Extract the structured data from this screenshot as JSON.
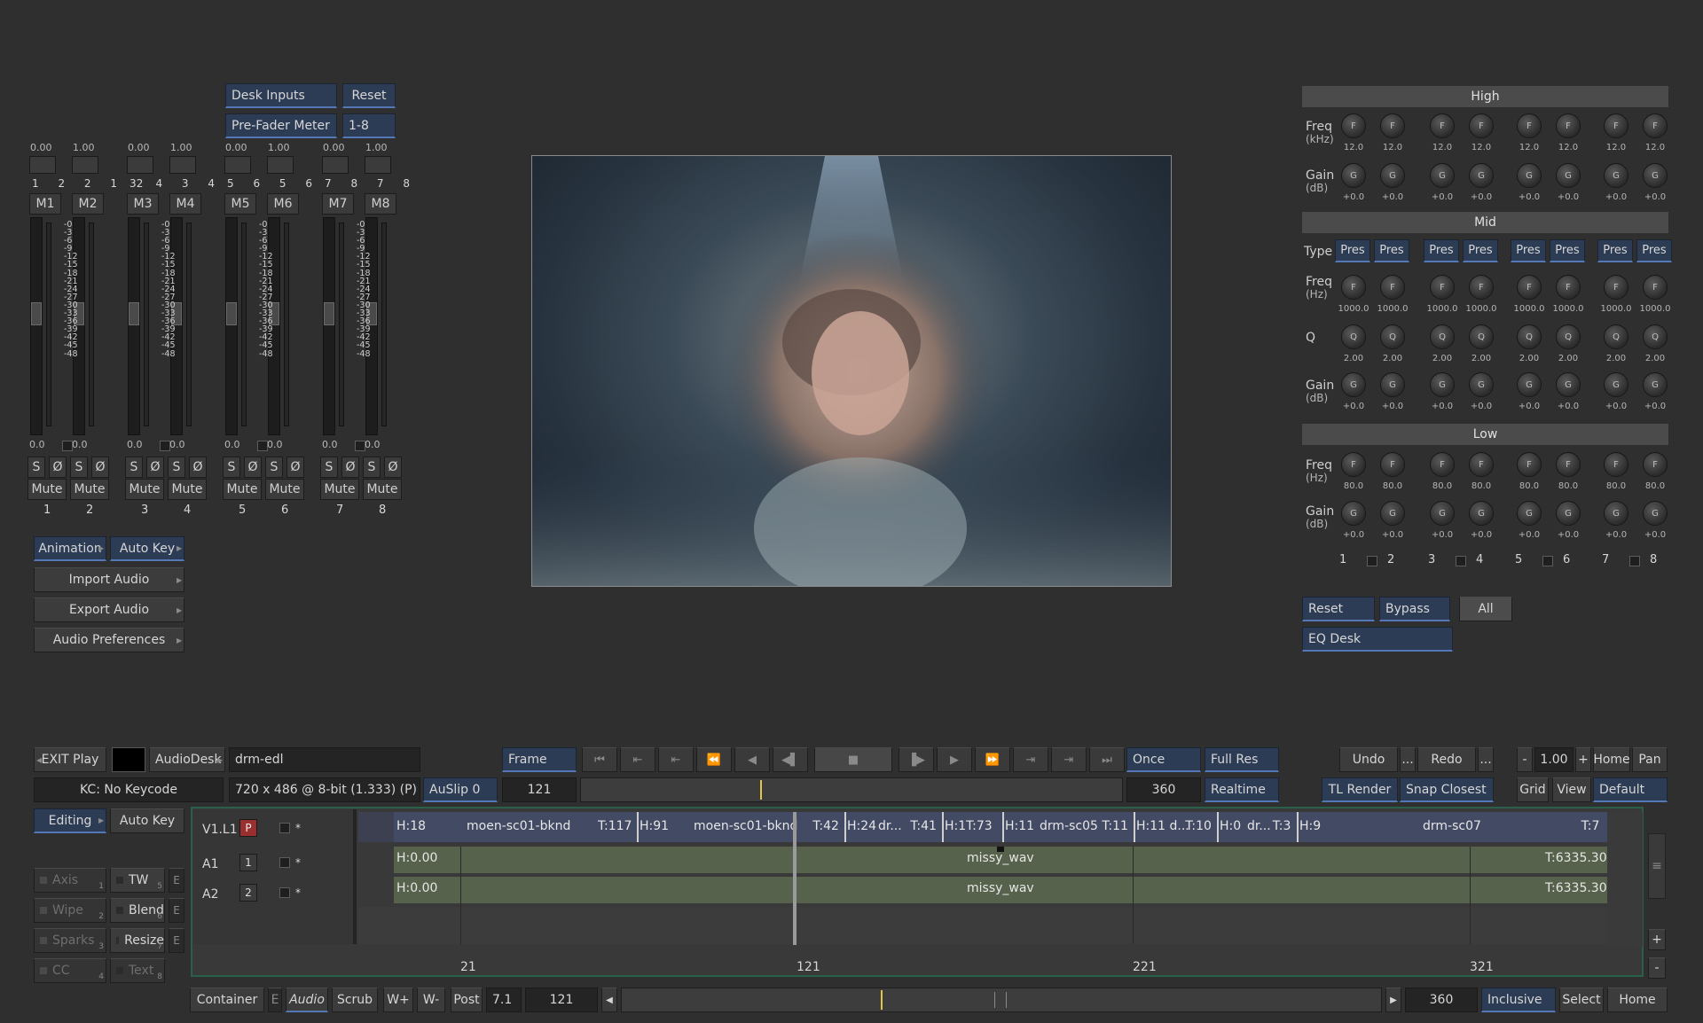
{
  "mixer": {
    "desk_inputs": "Desk Inputs",
    "reset": "Reset",
    "pre_fader_meter": "Pre-Fader Meter",
    "range": "1-8",
    "channel_labels": [
      "M1",
      "M2",
      "M3",
      "M4",
      "M5",
      "M6",
      "M7",
      "M8"
    ],
    "pan_values": [
      "0.00",
      "1.00"
    ],
    "input_numbers": [
      [
        "1",
        "2",
        "2",
        "1",
        "2"
      ],
      [
        "3",
        "4",
        "3",
        "4"
      ],
      [
        "5",
        "6",
        "5",
        "6"
      ],
      [
        "7",
        "8",
        "7",
        "8"
      ]
    ],
    "scale": "-0\n-3\n-6\n-9\n-12\n-15\n-18\n-21\n-24\n-27\n-30\n-33\n-36\n-39\n-42\n-45\n-48",
    "fader_value": "0.0",
    "solo": "S",
    "phase": "Ø",
    "mute": "Mute",
    "track_numbers": [
      "1",
      "2",
      "3",
      "4",
      "5",
      "6",
      "7",
      "8"
    ]
  },
  "side_menu": {
    "animation": "Animation",
    "auto_key": "Auto Key",
    "import_audio": "Import Audio",
    "export_audio": "Export Audio",
    "audio_preferences": "Audio Preferences"
  },
  "eq": {
    "high": "High",
    "mid": "Mid",
    "low": "Low",
    "freq": "Freq",
    "khz": "(kHz)",
    "hz": "(Hz)",
    "gain": "Gain",
    "db": "(dB)",
    "type": "Type",
    "q": "Q",
    "pres": "Pres",
    "f": "F",
    "g": "G",
    "qk": "Q",
    "high_freq": "12.0",
    "gain_val": "+0.0",
    "mid_freq": "1000.0",
    "q_val": "2.00",
    "low_freq": "80.0",
    "band_nums": [
      "1",
      "2",
      "3",
      "4",
      "5",
      "6",
      "7",
      "8"
    ],
    "reset": "Reset",
    "bypass": "Bypass",
    "all": "All",
    "eq_desk": "EQ Desk"
  },
  "transport": {
    "exit_play": "EXIT Play",
    "audiodesk": "AudioDesk",
    "edl_name": "drm-edl",
    "keycode": "KC: No Keycode",
    "format": "720 x 486 @ 8-bit (1.333) (P)",
    "frame": "Frame",
    "auslip": "AuSlip 0",
    "current_frame": "121",
    "end_frame": "360",
    "once": "Once",
    "realtime": "Realtime",
    "full_res": "Full Res",
    "undo": "Undo",
    "redo": "Redo",
    "ellipsis": "...",
    "minus": "-",
    "plus": "+",
    "zoom": "1.00",
    "home": "Home",
    "pan": "Pan",
    "tl_render": "TL Render",
    "snap": "Snap Closest",
    "grid": "Grid",
    "view": "View",
    "default": "Default",
    "editing": "Editing",
    "auto_key": "Auto Key"
  },
  "tools": {
    "axis": "Axis",
    "wipe": "Wipe",
    "sparks": "Sparks",
    "cc": "CC",
    "tw": "TW",
    "blend": "Blend",
    "resize": "Resize",
    "text": "Text",
    "e": "E",
    "n1": "1",
    "n2": "2",
    "n3": "3",
    "n4": "4",
    "n5": "5",
    "n6": "6",
    "n7": "7",
    "n8": "8"
  },
  "timeline": {
    "tracks": [
      {
        "name": "V1.L1",
        "tag": "P"
      },
      {
        "name": "A1",
        "tag": "1"
      },
      {
        "name": "A2",
        "tag": "2"
      }
    ],
    "star": "*",
    "v_clips": [
      {
        "h": "H:18",
        "name": "moen-sc01-bknd",
        "t": "T:117"
      },
      {
        "h": "H:91",
        "name": "moen-sc01-bknd",
        "t": "T:42"
      },
      {
        "h": "H:24",
        "name": "dr...",
        "t": "T:41"
      },
      {
        "h": "H:1T:73",
        "name": "",
        "t": ""
      },
      {
        "h": "H:11",
        "name": "drm-sc05",
        "t": "T:11"
      },
      {
        "h": "H:11 d...",
        "name": "",
        "t": "T:10"
      },
      {
        "h": "H:0",
        "name": "dr...",
        "t": "T:3"
      },
      {
        "h": "H:9",
        "name": "drm-sc07",
        "t": "T:7"
      }
    ],
    "audio_h": "H:0.00",
    "audio_name": "missy_wav",
    "audio_t": "T:6335.30",
    "ruler": [
      "21",
      "121",
      "221",
      "321"
    ]
  },
  "bottom": {
    "container": "Container",
    "e": "E",
    "audio": "Audio",
    "scrub": "Scrub",
    "wplus": "W+",
    "wminus": "W-",
    "post": "Post",
    "post_val": "7.1",
    "frame": "121",
    "end": "360",
    "inclusive": "Inclusive",
    "select": "Select",
    "home": "Home"
  }
}
